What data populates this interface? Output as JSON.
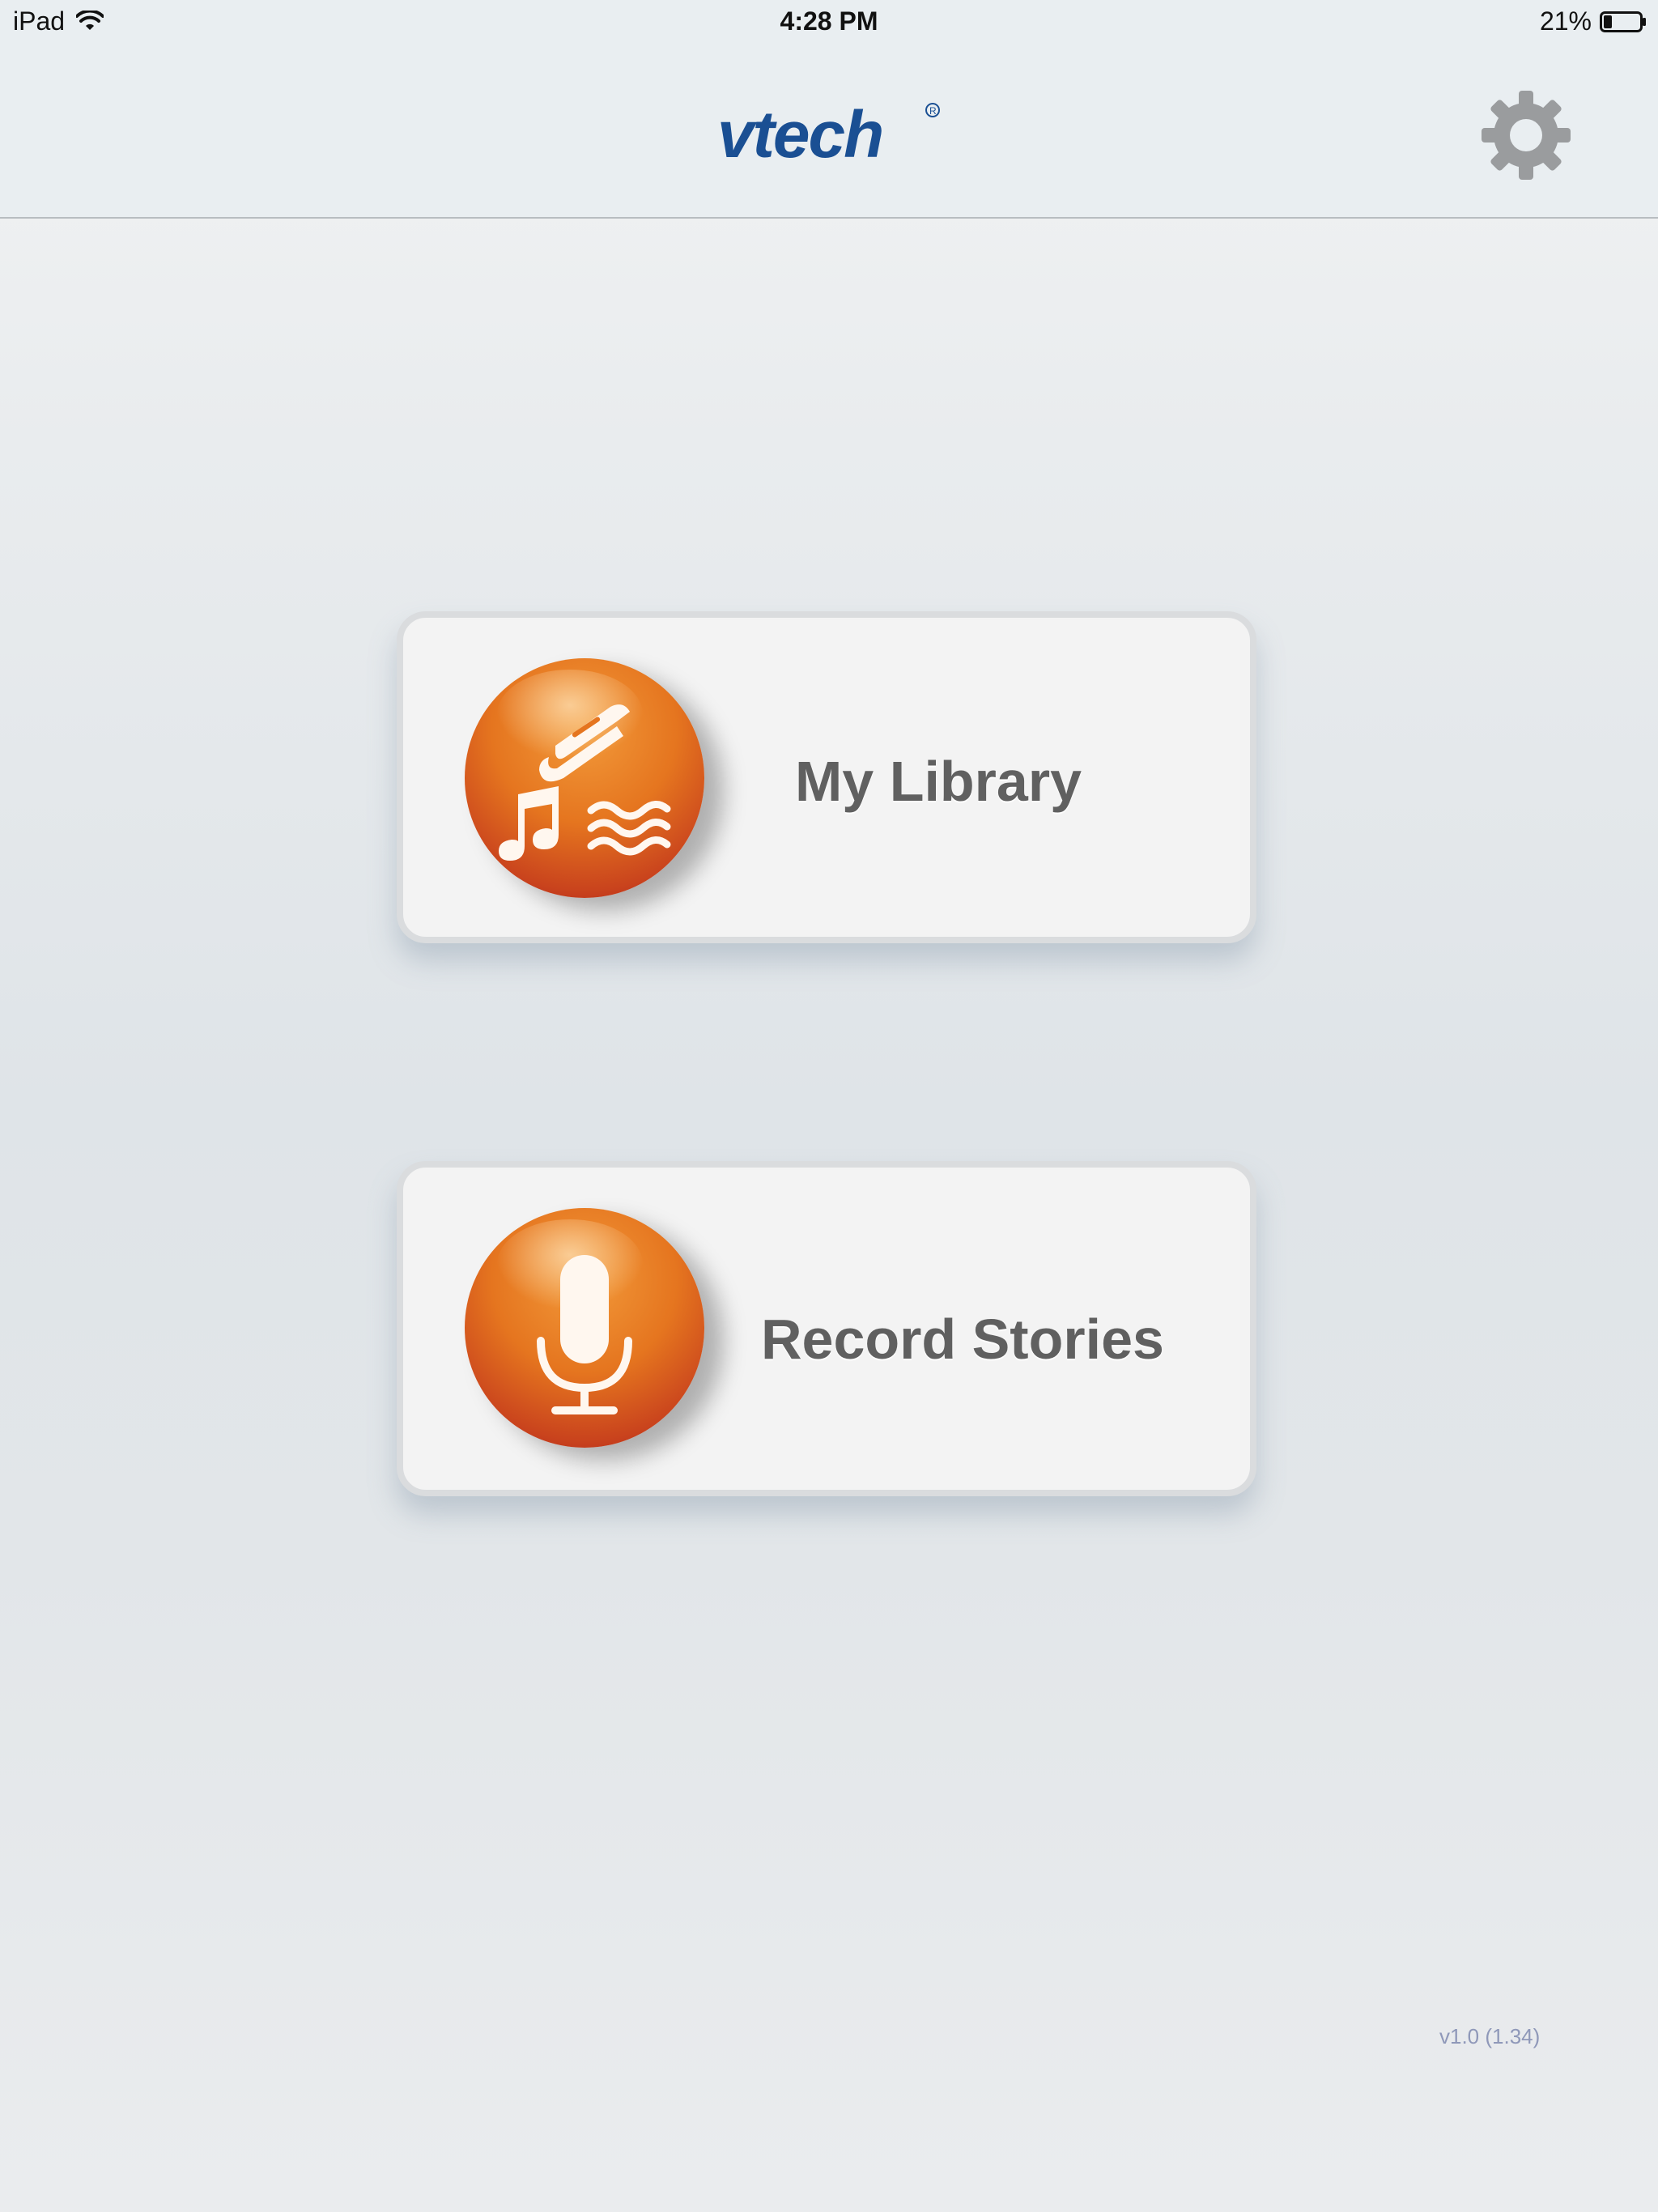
{
  "status_bar": {
    "device": "iPad",
    "time": "4:28 PM",
    "battery": "21%"
  },
  "header": {
    "logo_text": "vtech",
    "settings_icon": "gear-icon"
  },
  "menu": {
    "library_label": "My Library",
    "library_icon": "book-music-icon",
    "record_label": "Record Stories",
    "record_icon": "microphone-icon"
  },
  "footer": {
    "version": "v1.0 (1.34)"
  },
  "colors": {
    "logo_blue": "#1a4f93",
    "orb_orange": "#e5751f",
    "orb_red": "#a6191a",
    "label_gray": "#606060",
    "version_color": "#8f98b9"
  }
}
